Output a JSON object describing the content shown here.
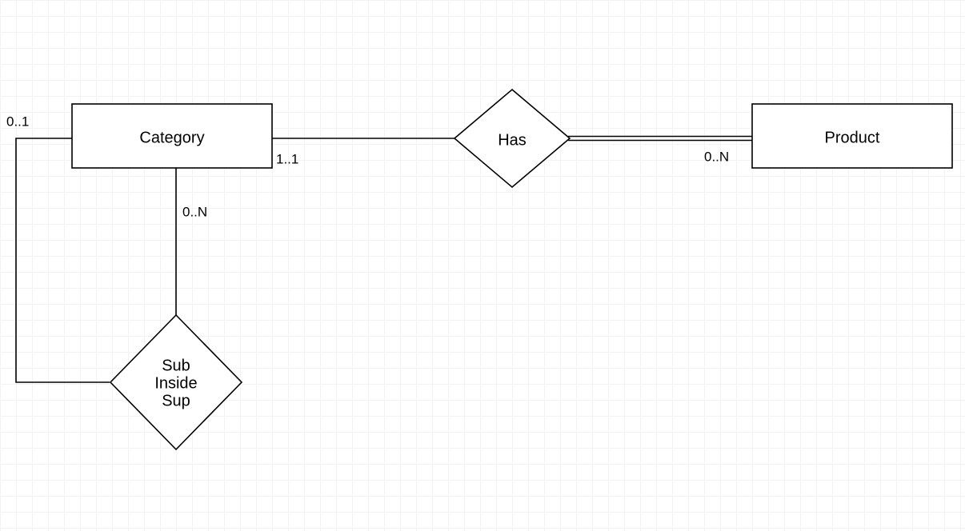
{
  "diagram": {
    "entities": {
      "category": {
        "label": "Category"
      },
      "product": {
        "label": "Product"
      }
    },
    "relationships": {
      "has": {
        "label": "Has"
      },
      "subinsidesup": {
        "line1": "Sub",
        "line2": "Inside",
        "line3": "Sup"
      }
    },
    "cardinalities": {
      "cat_to_has": "1..1",
      "has_to_prod": "0..N",
      "cat_to_sub": "0..N",
      "sub_to_cat": "0..1"
    }
  }
}
